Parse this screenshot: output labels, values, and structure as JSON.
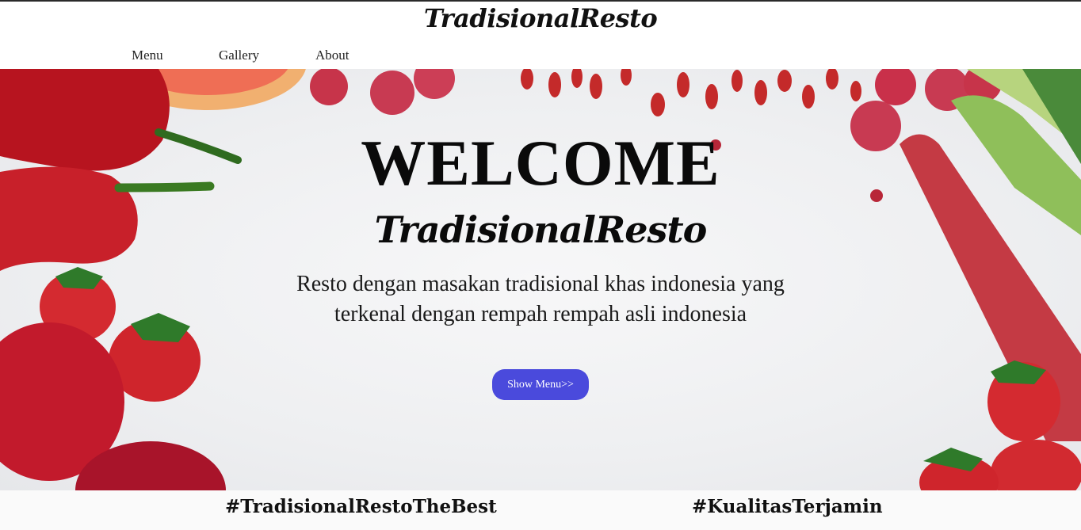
{
  "brand": {
    "logo_text": "TradisionalResto"
  },
  "nav": {
    "items": [
      {
        "label": "Menu"
      },
      {
        "label": "Gallery"
      },
      {
        "label": "About"
      }
    ]
  },
  "hero": {
    "heading": "WELCOME",
    "script_title": "TradisionalResto",
    "tagline": "Resto dengan masakan tradisional khas indonesia yang terkenal dengan rempah rempah asli indonesia",
    "button_label": "Show Menu>>"
  },
  "hashtags": [
    {
      "text": "#TradisionalRestoTheBest"
    },
    {
      "text": "#KualitasTerjamin"
    }
  ],
  "colors": {
    "accent": "#4a4adc",
    "fruit_red": "#c8202a"
  }
}
